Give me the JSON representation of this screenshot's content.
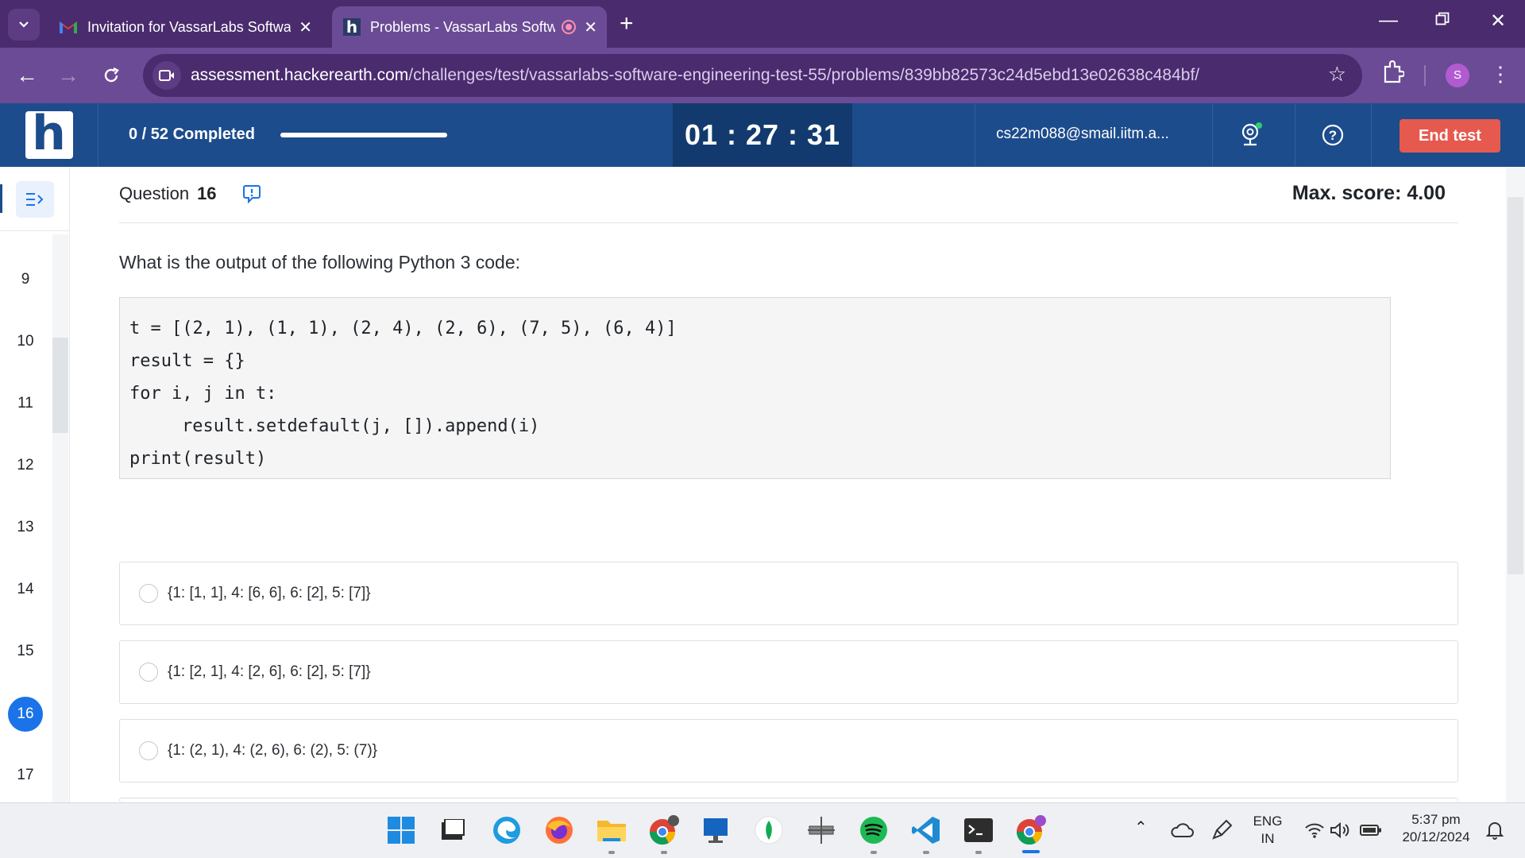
{
  "browser": {
    "tabs": [
      {
        "title": "Invitation for VassarLabs Software",
        "favicon": "gmail-icon"
      },
      {
        "title": "Problems - VassarLabs Software",
        "favicon": "hackerearth-icon",
        "active": true
      }
    ],
    "new_tab": "+",
    "url_host": "assessment.hackerearth.com",
    "url_path": "/challenges/test/vassarlabs-software-engineering-test-55/problems/839bb82573c24d5ebd13e02638c484bf/",
    "profile_initial": "S"
  },
  "header": {
    "logo_letter": "h",
    "progress_text": "0 / 52 Completed",
    "progress_fraction": 0.0,
    "timer": "01 : 27 : 31",
    "email": "cs22m088@smail.iitm.a...",
    "end_test": "End test"
  },
  "nav": {
    "numbers": [
      "9",
      "10",
      "11",
      "12",
      "13",
      "14",
      "15",
      "16",
      "17"
    ],
    "active": "16"
  },
  "question": {
    "label": "Question",
    "number": "16",
    "max_score": "Max. score: 4.00",
    "prompt": "What is the output of the following Python 3 code:",
    "code": [
      "t = [(2, 1), (1, 1), (2, 4), (2, 6), (7, 5), (6, 4)]",
      "result = {}",
      "for i, j in t:",
      "result.setdefault(j, []).append(i)",
      "print(result)"
    ],
    "options": [
      "{1: [1, 1], 4: [6, 6], 6: [2], 5: [7]}",
      "{1: [2, 1], 4: [2, 6], 6: [2], 5: [7]}",
      "{1: (2, 1), 4: (2, 6), 6: (2), 5: (7)}"
    ]
  },
  "taskbar": {
    "apps": [
      "windows-start-icon",
      "file-explorer-icon",
      "edge-icon",
      "firefox-icon",
      "folder-icon",
      "chrome-icon",
      "vm-icon",
      "mongodb-icon",
      "dropper-icon",
      "spotify-icon",
      "vscode-icon",
      "terminal-icon",
      "chrome-profile-icon"
    ],
    "lang_top": "ENG",
    "lang_bottom": "IN",
    "time": "5:37 pm",
    "date": "20/12/2024"
  },
  "colors": {
    "tab_strip": "#4a2b6e",
    "address_bar": "#6b4b95",
    "header_blue": "#1c4c8c",
    "timer_bg": "#123a6e",
    "end_test": "#e5594f",
    "active_question": "#1a73e8"
  }
}
